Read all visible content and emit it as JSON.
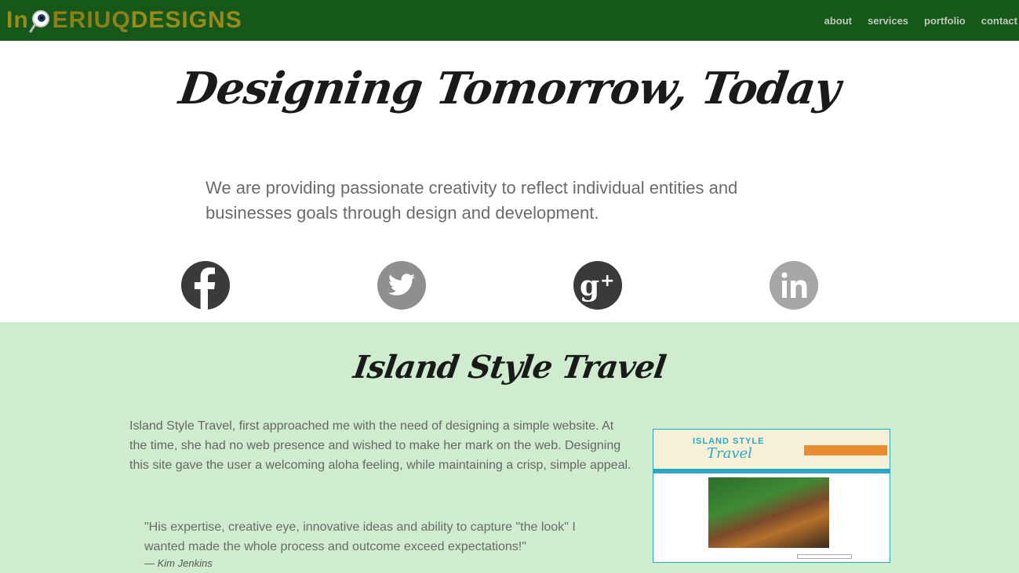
{
  "brand": {
    "logo_part1": "In",
    "logo_part2": "ERIUQ",
    "logo_part3": "DESIGNS"
  },
  "nav": {
    "items": [
      "about",
      "services",
      "portfolio",
      "contact"
    ]
  },
  "hero": {
    "title": "Designing Tomorrow, Today",
    "subtitle": "We are providing passionate creativity to reflect individual entities and businesses goals through design and development."
  },
  "social": {
    "icons": [
      "facebook-icon",
      "twitter-icon",
      "google-plus-icon",
      "linkedin-icon"
    ]
  },
  "portfolio": {
    "title": "Island Style Travel",
    "description": "Island Style Travel, first approached me with the need of designing a simple website. At the time, she had no web presence and wished to make her mark on the web. Designing this site gave the user a welcoming aloha feeling, while maintaining a crisp, simple appeal.",
    "quote": "\"His expertise, creative eye, innovative ideas and ability to capture \"the look\" I wanted made the whole process and outcome exceed expectations!\"",
    "author": "— Kim Jenkins",
    "thumbnail": {
      "brand_line1": "ISLAND STYLE",
      "brand_line2": "Travel"
    }
  },
  "colors": {
    "nav_bg": "#15581a",
    "section_bg": "#cfeccf",
    "accent": "#2aa7c5",
    "logo_gold": "#9a8a1a"
  }
}
